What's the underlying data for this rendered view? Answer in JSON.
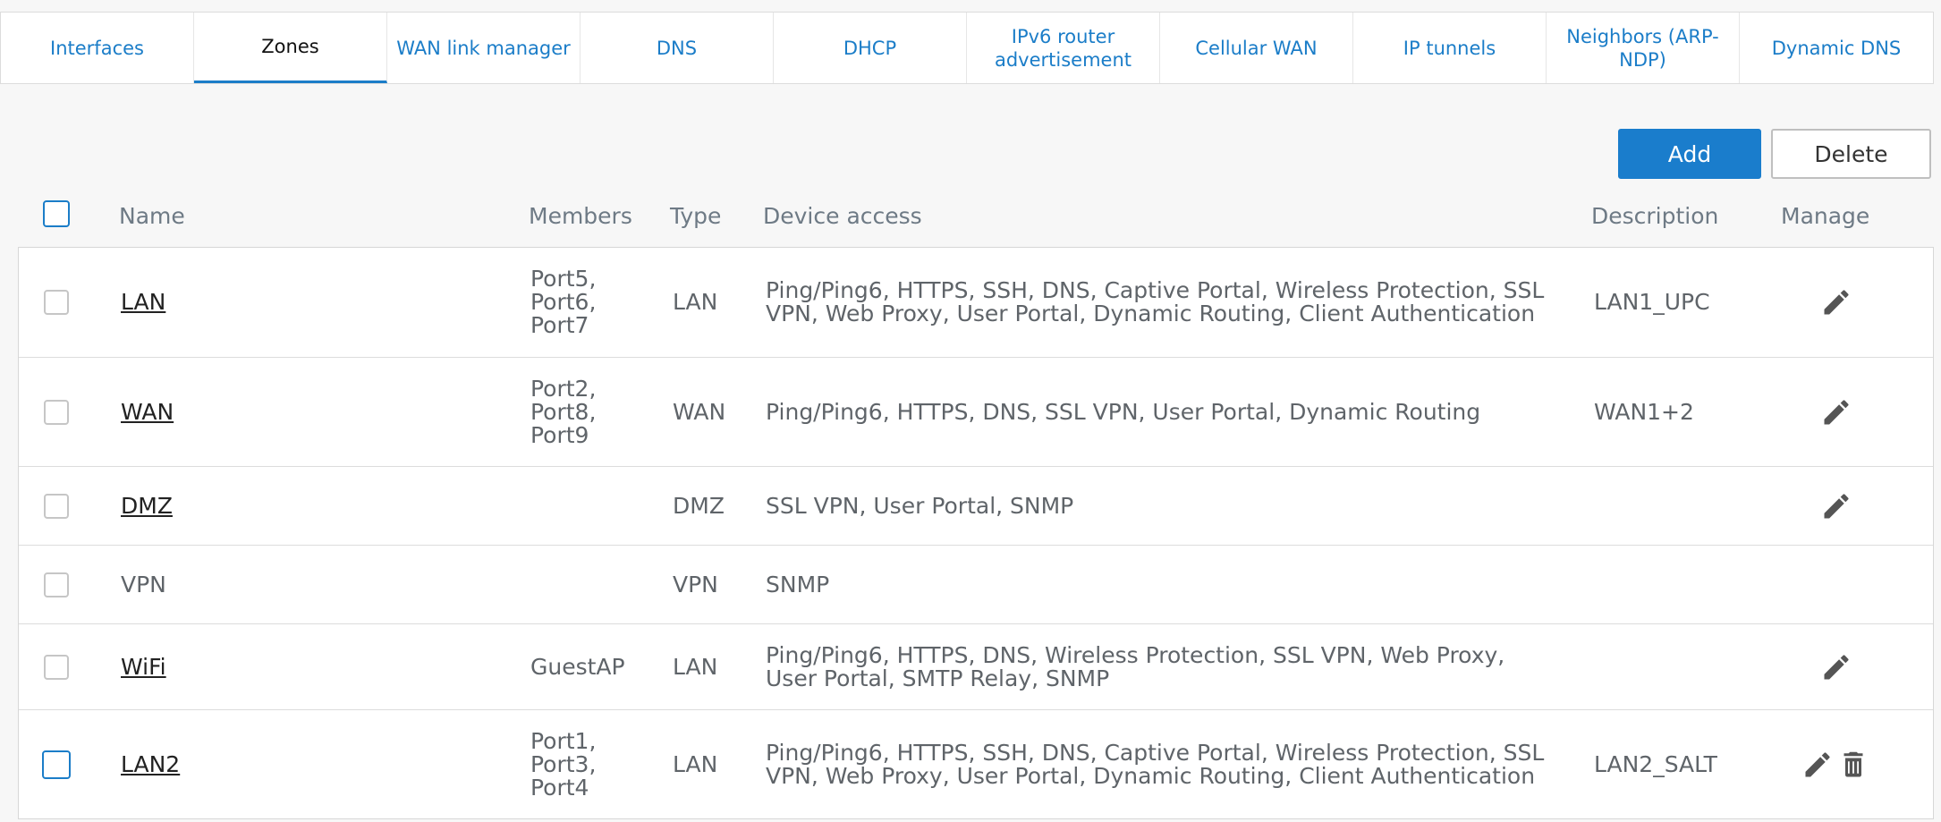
{
  "tabs": [
    {
      "label": "Interfaces",
      "active": false
    },
    {
      "label": "Zones",
      "active": true
    },
    {
      "label": "WAN link manager",
      "active": false
    },
    {
      "label": "DNS",
      "active": false
    },
    {
      "label": "DHCP",
      "active": false
    },
    {
      "label": "IPv6 router advertisement",
      "active": false
    },
    {
      "label": "Cellular WAN",
      "active": false
    },
    {
      "label": "IP tunnels",
      "active": false
    },
    {
      "label": "Neighbors (ARP-NDP)",
      "active": false
    },
    {
      "label": "Dynamic DNS",
      "active": false
    }
  ],
  "toolbar": {
    "add_label": "Add",
    "delete_label": "Delete"
  },
  "columns": {
    "name": "Name",
    "members": "Members",
    "type": "Type",
    "device_access": "Device access",
    "description": "Description",
    "manage": "Manage"
  },
  "rows": [
    {
      "name": "LAN",
      "members": "Port5, Port6, Port7",
      "type": "LAN",
      "device_access": "Ping/Ping6, HTTPS, SSH, DNS, Captive Portal, Wireless Protection, SSL VPN, Web Proxy, User Portal, Dynamic Routing, Client Authentication",
      "description": "LAN1_UPC"
    },
    {
      "name": "WAN",
      "members": "Port2, Port8, Port9",
      "type": "WAN",
      "device_access": "Ping/Ping6, HTTPS, DNS, SSL VPN, User Portal, Dynamic Routing",
      "description": "WAN1+2"
    },
    {
      "name": "DMZ",
      "members": "",
      "type": "DMZ",
      "device_access": "SSL VPN, User Portal, SNMP",
      "description": ""
    },
    {
      "name": "VPN",
      "members": "",
      "type": "VPN",
      "device_access": "SNMP",
      "description": ""
    },
    {
      "name": "WiFi",
      "members": "GuestAP",
      "type": "LAN",
      "device_access": "Ping/Ping6, HTTPS, DNS, Wireless Protection, SSL VPN, Web Proxy, User Portal, SMTP Relay, SNMP",
      "description": ""
    },
    {
      "name": "LAN2",
      "members": "Port1, Port3, Port4",
      "type": "LAN",
      "device_access": "Ping/Ping6, HTTPS, SSH, DNS, Captive Portal, Wireless Protection, SSL VPN, Web Proxy, User Portal, Dynamic Routing, Client Authentication",
      "description": "LAN2_SALT"
    }
  ],
  "icons": {
    "edit": "pencil-icon",
    "delete": "trash-icon"
  },
  "colors": {
    "accent": "#1b7dc8",
    "add_button": "#1a7dcc"
  }
}
